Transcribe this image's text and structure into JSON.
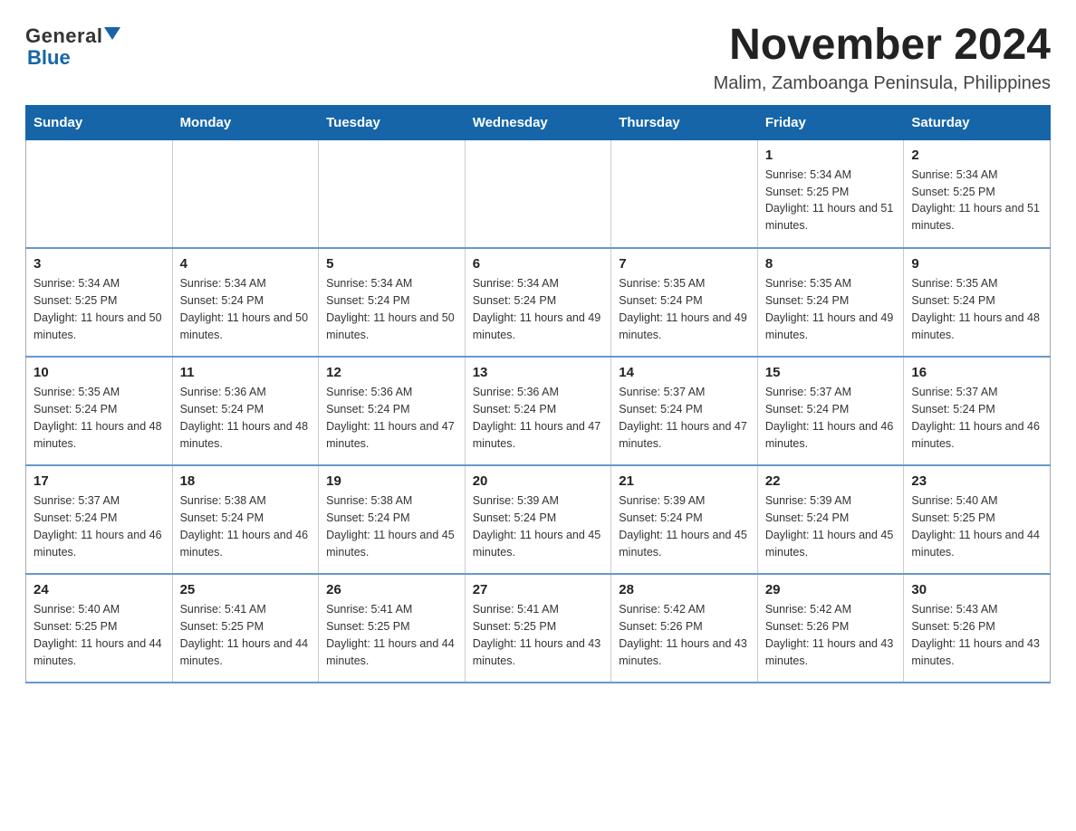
{
  "logo": {
    "general": "General",
    "blue": "Blue"
  },
  "title": "November 2024",
  "subtitle": "Malim, Zamboanga Peninsula, Philippines",
  "days_of_week": [
    "Sunday",
    "Monday",
    "Tuesday",
    "Wednesday",
    "Thursday",
    "Friday",
    "Saturday"
  ],
  "weeks": [
    [
      {
        "day": "",
        "info": ""
      },
      {
        "day": "",
        "info": ""
      },
      {
        "day": "",
        "info": ""
      },
      {
        "day": "",
        "info": ""
      },
      {
        "day": "",
        "info": ""
      },
      {
        "day": "1",
        "info": "Sunrise: 5:34 AM\nSunset: 5:25 PM\nDaylight: 11 hours and 51 minutes."
      },
      {
        "day": "2",
        "info": "Sunrise: 5:34 AM\nSunset: 5:25 PM\nDaylight: 11 hours and 51 minutes."
      }
    ],
    [
      {
        "day": "3",
        "info": "Sunrise: 5:34 AM\nSunset: 5:25 PM\nDaylight: 11 hours and 50 minutes."
      },
      {
        "day": "4",
        "info": "Sunrise: 5:34 AM\nSunset: 5:24 PM\nDaylight: 11 hours and 50 minutes."
      },
      {
        "day": "5",
        "info": "Sunrise: 5:34 AM\nSunset: 5:24 PM\nDaylight: 11 hours and 50 minutes."
      },
      {
        "day": "6",
        "info": "Sunrise: 5:34 AM\nSunset: 5:24 PM\nDaylight: 11 hours and 49 minutes."
      },
      {
        "day": "7",
        "info": "Sunrise: 5:35 AM\nSunset: 5:24 PM\nDaylight: 11 hours and 49 minutes."
      },
      {
        "day": "8",
        "info": "Sunrise: 5:35 AM\nSunset: 5:24 PM\nDaylight: 11 hours and 49 minutes."
      },
      {
        "day": "9",
        "info": "Sunrise: 5:35 AM\nSunset: 5:24 PM\nDaylight: 11 hours and 48 minutes."
      }
    ],
    [
      {
        "day": "10",
        "info": "Sunrise: 5:35 AM\nSunset: 5:24 PM\nDaylight: 11 hours and 48 minutes."
      },
      {
        "day": "11",
        "info": "Sunrise: 5:36 AM\nSunset: 5:24 PM\nDaylight: 11 hours and 48 minutes."
      },
      {
        "day": "12",
        "info": "Sunrise: 5:36 AM\nSunset: 5:24 PM\nDaylight: 11 hours and 47 minutes."
      },
      {
        "day": "13",
        "info": "Sunrise: 5:36 AM\nSunset: 5:24 PM\nDaylight: 11 hours and 47 minutes."
      },
      {
        "day": "14",
        "info": "Sunrise: 5:37 AM\nSunset: 5:24 PM\nDaylight: 11 hours and 47 minutes."
      },
      {
        "day": "15",
        "info": "Sunrise: 5:37 AM\nSunset: 5:24 PM\nDaylight: 11 hours and 46 minutes."
      },
      {
        "day": "16",
        "info": "Sunrise: 5:37 AM\nSunset: 5:24 PM\nDaylight: 11 hours and 46 minutes."
      }
    ],
    [
      {
        "day": "17",
        "info": "Sunrise: 5:37 AM\nSunset: 5:24 PM\nDaylight: 11 hours and 46 minutes."
      },
      {
        "day": "18",
        "info": "Sunrise: 5:38 AM\nSunset: 5:24 PM\nDaylight: 11 hours and 46 minutes."
      },
      {
        "day": "19",
        "info": "Sunrise: 5:38 AM\nSunset: 5:24 PM\nDaylight: 11 hours and 45 minutes."
      },
      {
        "day": "20",
        "info": "Sunrise: 5:39 AM\nSunset: 5:24 PM\nDaylight: 11 hours and 45 minutes."
      },
      {
        "day": "21",
        "info": "Sunrise: 5:39 AM\nSunset: 5:24 PM\nDaylight: 11 hours and 45 minutes."
      },
      {
        "day": "22",
        "info": "Sunrise: 5:39 AM\nSunset: 5:24 PM\nDaylight: 11 hours and 45 minutes."
      },
      {
        "day": "23",
        "info": "Sunrise: 5:40 AM\nSunset: 5:25 PM\nDaylight: 11 hours and 44 minutes."
      }
    ],
    [
      {
        "day": "24",
        "info": "Sunrise: 5:40 AM\nSunset: 5:25 PM\nDaylight: 11 hours and 44 minutes."
      },
      {
        "day": "25",
        "info": "Sunrise: 5:41 AM\nSunset: 5:25 PM\nDaylight: 11 hours and 44 minutes."
      },
      {
        "day": "26",
        "info": "Sunrise: 5:41 AM\nSunset: 5:25 PM\nDaylight: 11 hours and 44 minutes."
      },
      {
        "day": "27",
        "info": "Sunrise: 5:41 AM\nSunset: 5:25 PM\nDaylight: 11 hours and 43 minutes."
      },
      {
        "day": "28",
        "info": "Sunrise: 5:42 AM\nSunset: 5:26 PM\nDaylight: 11 hours and 43 minutes."
      },
      {
        "day": "29",
        "info": "Sunrise: 5:42 AM\nSunset: 5:26 PM\nDaylight: 11 hours and 43 minutes."
      },
      {
        "day": "30",
        "info": "Sunrise: 5:43 AM\nSunset: 5:26 PM\nDaylight: 11 hours and 43 minutes."
      }
    ]
  ]
}
